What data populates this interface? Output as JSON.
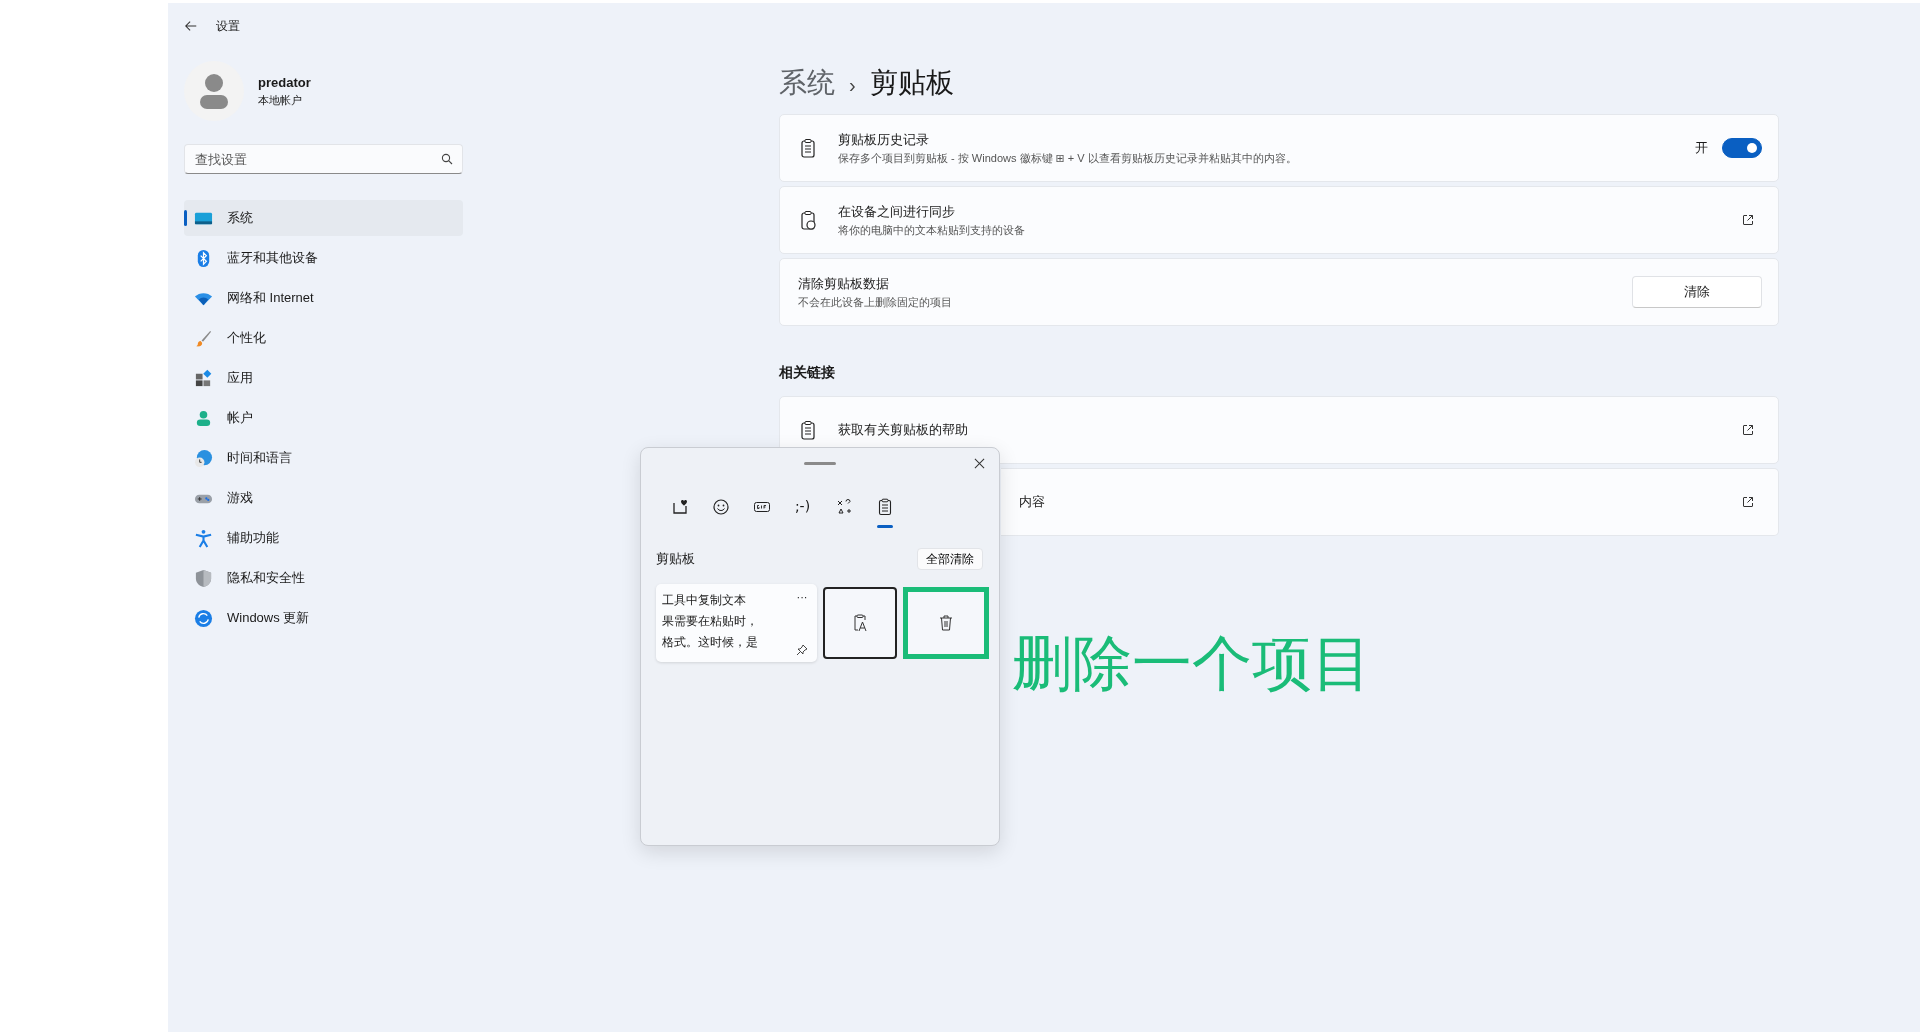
{
  "window": {
    "title": "设置"
  },
  "account": {
    "name": "predator",
    "type": "本地帐户"
  },
  "search": {
    "placeholder": "查找设置"
  },
  "sidebar": {
    "items": [
      {
        "label": "系统",
        "kind": "display",
        "selected": true
      },
      {
        "label": "蓝牙和其他设备",
        "kind": "bluetooth",
        "selected": false
      },
      {
        "label": "网络和 Internet",
        "kind": "wifi",
        "selected": false
      },
      {
        "label": "个性化",
        "kind": "brush",
        "selected": false
      },
      {
        "label": "应用",
        "kind": "apps",
        "selected": false
      },
      {
        "label": "帐户",
        "kind": "person",
        "selected": false
      },
      {
        "label": "时间和语言",
        "kind": "globe",
        "selected": false
      },
      {
        "label": "游戏",
        "kind": "gamepad",
        "selected": false
      },
      {
        "label": "辅助功能",
        "kind": "accessibility",
        "selected": false
      },
      {
        "label": "隐私和安全性",
        "kind": "shield",
        "selected": false
      },
      {
        "label": "Windows 更新",
        "kind": "update",
        "selected": false
      }
    ]
  },
  "breadcrumb": {
    "parent": "系统",
    "separator": "›",
    "current": "剪贴板"
  },
  "settings": [
    {
      "kind": "toggle",
      "title": "剪贴板历史记录",
      "description": "保存多个项目到剪贴板 - 按 Windows 徽标键 ⊞ + V 以查看剪贴板历史记录并粘贴其中的内容。",
      "state_label": "开",
      "on": true
    },
    {
      "kind": "link",
      "title": "在设备之间进行同步",
      "description": "将你的电脑中的文本粘贴到支持的设备"
    },
    {
      "kind": "button",
      "title": "清除剪贴板数据",
      "description": "不会在此设备上删除固定的项目",
      "button": "清除"
    }
  ],
  "related": {
    "heading": "相关链接",
    "links": [
      {
        "title": "获取有关剪贴板的帮助"
      },
      {
        "title": "内容"
      }
    ]
  },
  "popup": {
    "tabs": [
      {
        "kind": "favorites",
        "selected": false
      },
      {
        "kind": "emoji",
        "selected": false
      },
      {
        "kind": "gif",
        "selected": false
      },
      {
        "kind": "kaomoji",
        "label": ";-)",
        "selected": false
      },
      {
        "kind": "symbols",
        "selected": false
      },
      {
        "kind": "clipboard",
        "selected": true
      }
    ],
    "heading": "剪贴板",
    "clear_all": "全部清除",
    "item": {
      "lines": [
        "工具中复制文本",
        "果需要在粘贴时，",
        "格式。这时候，是"
      ],
      "more": "···"
    }
  },
  "annotation": "删除一个项目"
}
